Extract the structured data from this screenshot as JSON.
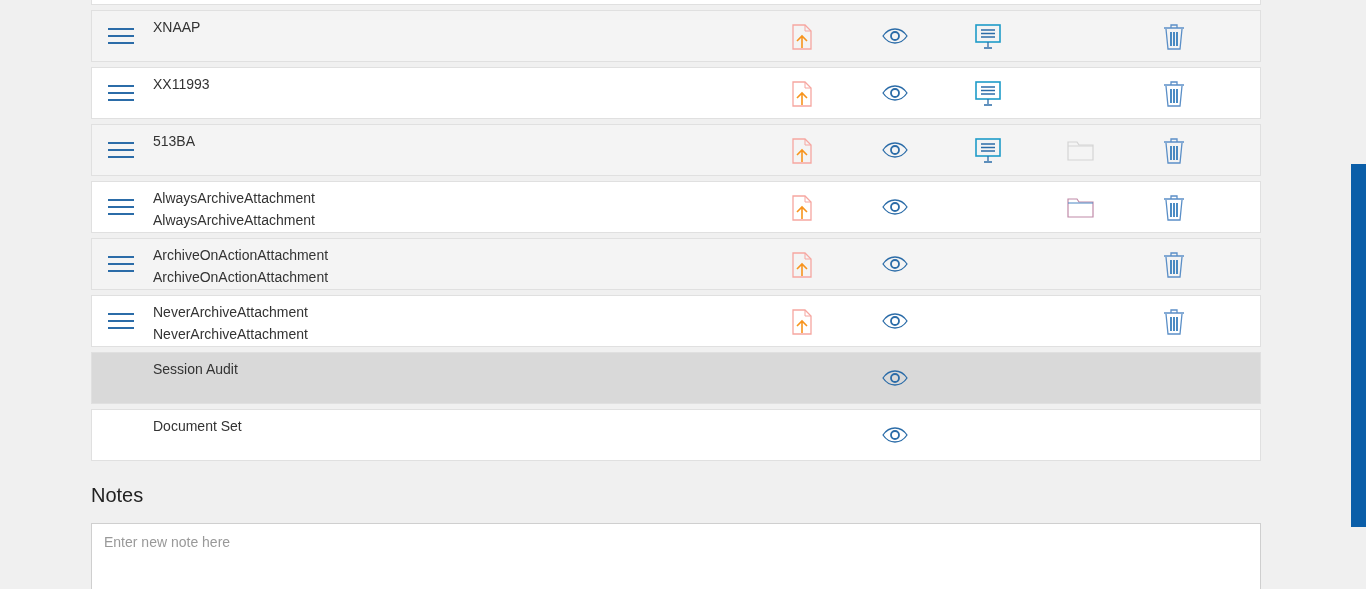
{
  "rows": [
    {
      "lines": [
        "XNAAP"
      ],
      "draggable": true,
      "upload": true,
      "view": true,
      "present": true,
      "delete": true,
      "selected": false
    },
    {
      "lines": [
        "XX11993"
      ],
      "draggable": true,
      "upload": true,
      "view": true,
      "present": true,
      "delete": true,
      "selected": false
    },
    {
      "lines": [
        "513BA"
      ],
      "draggable": true,
      "upload": true,
      "view": true,
      "present": true,
      "folder": {
        "disabled": true
      },
      "delete": true,
      "selected": false
    },
    {
      "lines": [
        "AlwaysArchiveAttachment",
        "AlwaysArchiveAttachment"
      ],
      "draggable": true,
      "upload": true,
      "view": true,
      "present": false,
      "folder": {
        "disabled": false
      },
      "delete": true,
      "selected": false
    },
    {
      "lines": [
        "ArchiveOnActionAttachment",
        "ArchiveOnActionAttachment"
      ],
      "draggable": true,
      "upload": true,
      "view": true,
      "present": false,
      "delete": true,
      "selected": false
    },
    {
      "lines": [
        "NeverArchiveAttachment",
        "NeverArchiveAttachment"
      ],
      "draggable": true,
      "upload": true,
      "view": true,
      "present": false,
      "delete": true,
      "selected": false
    },
    {
      "lines": [
        "Session Audit"
      ],
      "draggable": false,
      "upload": false,
      "view": true,
      "present": false,
      "delete": false,
      "selected": true
    },
    {
      "lines": [
        "Document Set"
      ],
      "draggable": false,
      "upload": false,
      "view": true,
      "present": false,
      "delete": false,
      "selected": false
    }
  ],
  "notes": {
    "title": "Notes",
    "placeholder": "Enter new note here"
  }
}
